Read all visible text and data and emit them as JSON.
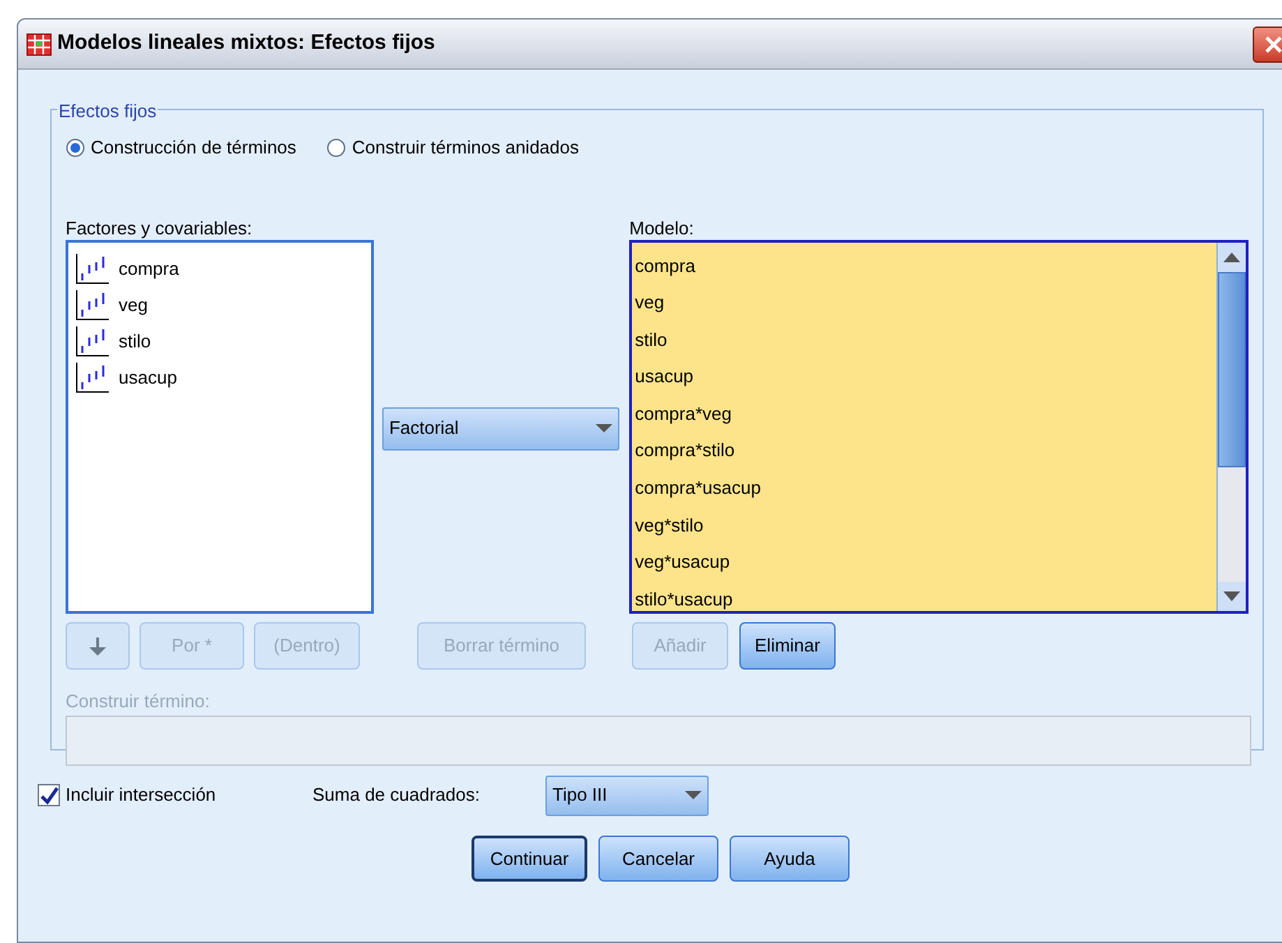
{
  "window": {
    "title": "Modelos lineales mixtos: Efectos fijos"
  },
  "group": {
    "legend": "Efectos fijos",
    "modes": [
      {
        "label": "Construcción de términos",
        "selected": true
      },
      {
        "label": "Construir términos anidados",
        "selected": false
      }
    ]
  },
  "factors": {
    "label": "Factores y covariables:",
    "items": [
      "compra",
      "veg",
      "stilo",
      "usacup"
    ]
  },
  "build_type": {
    "value": "Factorial"
  },
  "model": {
    "label": "Modelo:",
    "items": [
      "compra",
      "veg",
      "stilo",
      "usacup",
      "compra*veg",
      "compra*stilo",
      "compra*usacup",
      "veg*stilo",
      "veg*usacup",
      "stilo*usacup"
    ]
  },
  "left_buttons": [
    {
      "kind": "arrow",
      "disabled": true
    },
    {
      "kind": "text",
      "label": "Por *",
      "disabled": true
    },
    {
      "kind": "text",
      "label": "(Dentro)",
      "disabled": true
    }
  ],
  "clear_button": {
    "label": "Borrar término",
    "disabled": true
  },
  "model_buttons": [
    {
      "label": "Añadir",
      "disabled": true
    },
    {
      "label": "Eliminar",
      "disabled": false
    }
  ],
  "term": {
    "label": "Construir término:",
    "disabled": true
  },
  "intercept": {
    "label": "Incluir intersección",
    "checked": true
  },
  "sum_of_squares": {
    "label": "Suma de cuadrados:",
    "value": "Tipo III"
  },
  "buttons": [
    {
      "label": "Continuar",
      "default": true
    },
    {
      "label": "Cancelar",
      "default": false
    },
    {
      "label": "Ayuda",
      "default": false
    }
  ]
}
